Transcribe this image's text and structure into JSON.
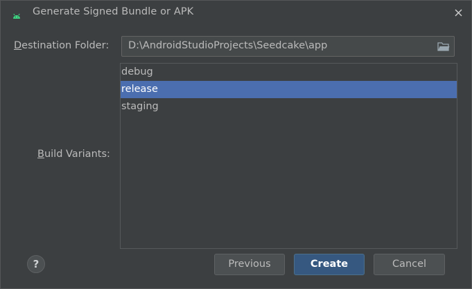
{
  "window": {
    "title": "Generate Signed Bundle or APK",
    "icon": "android-icon",
    "icon_color": "#3ddc84"
  },
  "form": {
    "destination_folder": {
      "label_mnemonic": "D",
      "label_rest": "estination Folder:",
      "value": "D:\\AndroidStudioProjects\\Seedcake\\app"
    },
    "build_variants": {
      "label_mnemonic": "B",
      "label_rest": "uild Variants:",
      "items": [
        "debug",
        "release",
        "staging"
      ],
      "selected": "release"
    }
  },
  "footer": {
    "help_label": "?",
    "previous_label": "Previous",
    "create_label": "Create",
    "cancel_label": "Cancel"
  },
  "colors": {
    "background": "#3c3f41",
    "selection": "#4b6eaf",
    "default_button": "#365880"
  }
}
